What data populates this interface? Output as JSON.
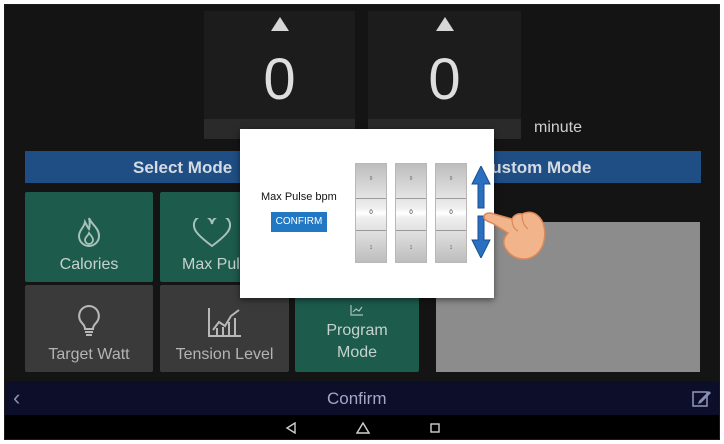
{
  "spinners": [
    {
      "value": "0"
    },
    {
      "value": "0",
      "unit": "minute"
    }
  ],
  "select_mode_label": "Select Mode",
  "custom_mode_label": "Custom Mode",
  "tiles": [
    {
      "label": "Calories",
      "icon": "flame-icon"
    },
    {
      "label": "Max Pulse",
      "icon": "heart-icon"
    },
    {
      "label": "Target Watt",
      "icon": "lightbulb-icon"
    },
    {
      "label": "Tension Level",
      "icon": "chart-icon"
    },
    {
      "label_line1": "Program",
      "label_line2": "Mode",
      "icon": "chart-icon"
    }
  ],
  "nav": {
    "confirm_label": "Confirm"
  },
  "dialog": {
    "title": "Max Pulse bpm",
    "confirm_button": "CONFIRM",
    "digits": [
      {
        "above": "9",
        "value": "0",
        "below": "1"
      },
      {
        "above": "9",
        "value": "0",
        "below": "1"
      },
      {
        "above": "9",
        "value": "0",
        "below": "1"
      }
    ]
  },
  "colors": {
    "accent": "#2278c3",
    "teal": "#1d5b4c",
    "bar_blue": "#1e4e84",
    "arrow_blue": "#2a6fc0",
    "hand": "#f2b48a"
  }
}
